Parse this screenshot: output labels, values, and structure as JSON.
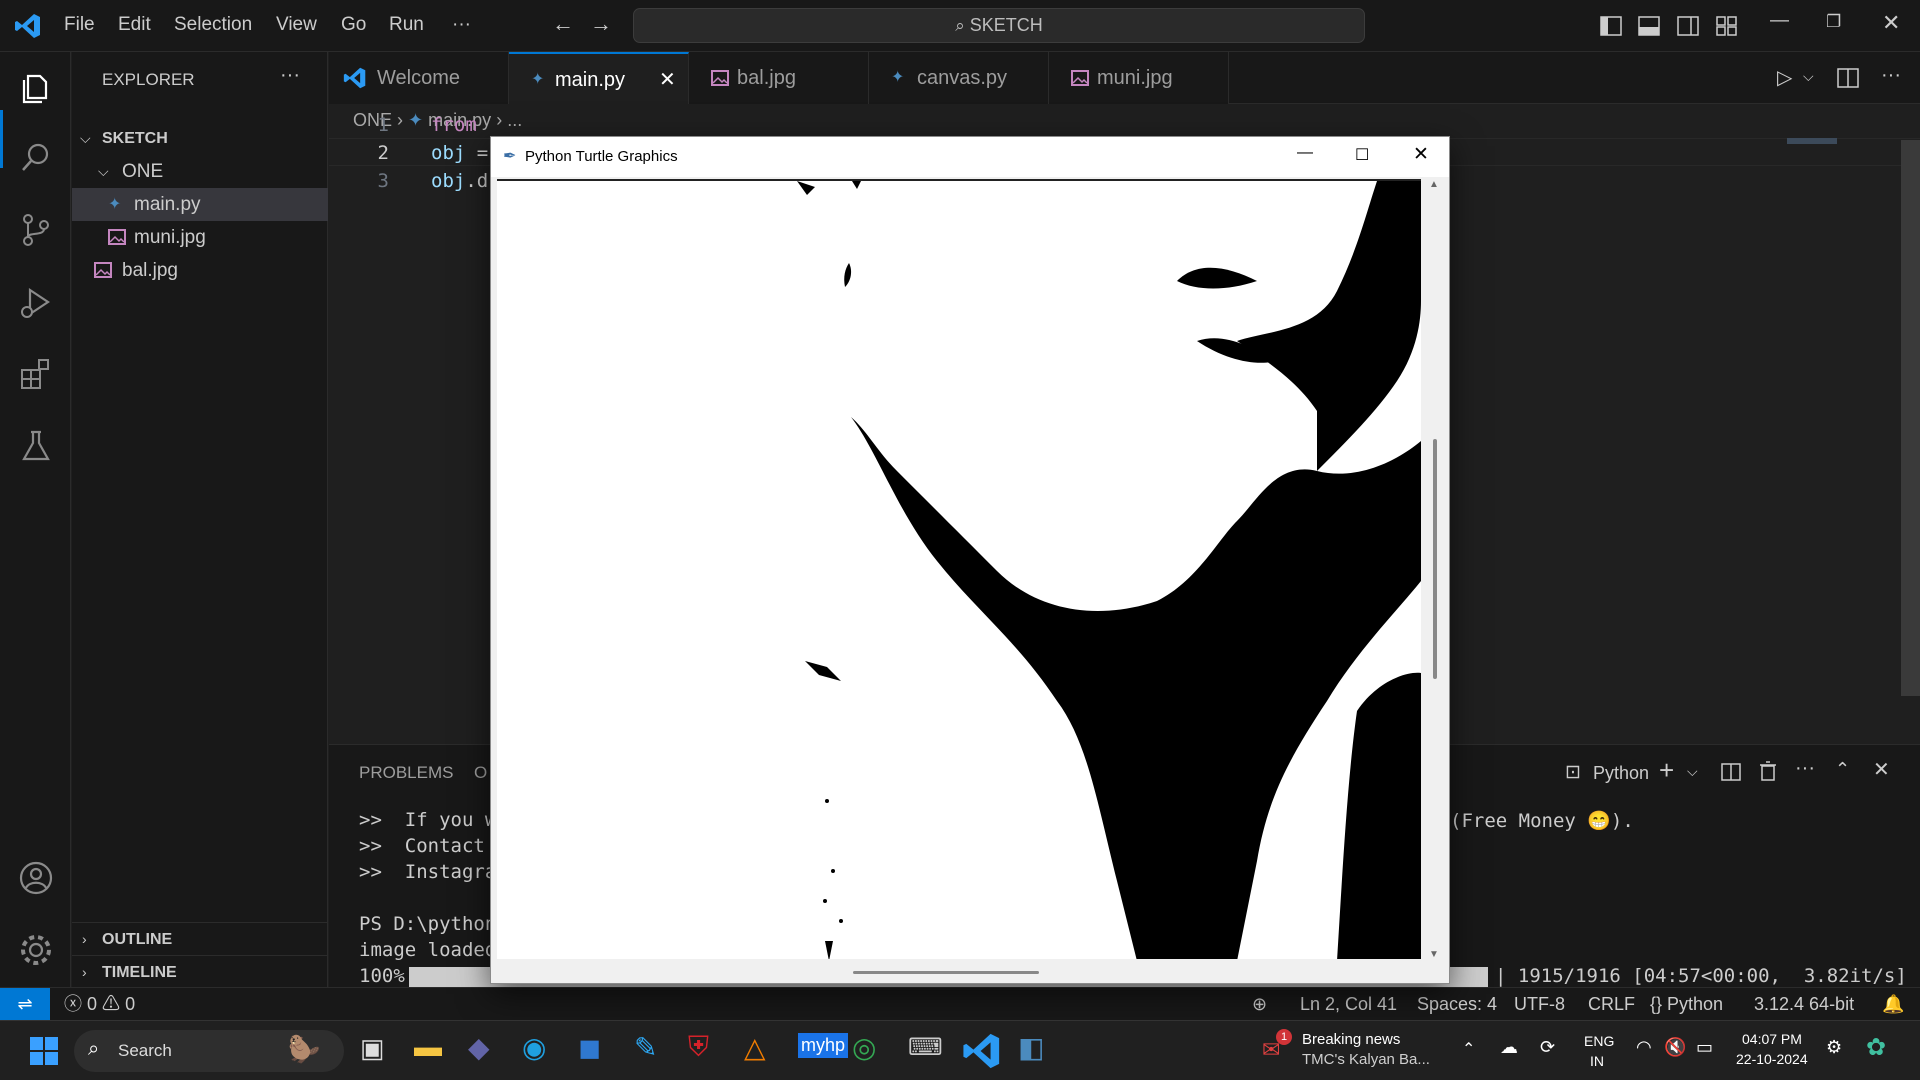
{
  "titlebar": {
    "menu": [
      "File",
      "Edit",
      "Selection",
      "View",
      "Go",
      "Run"
    ],
    "more": "···",
    "search_text": "SKETCH"
  },
  "sidebar": {
    "header": "EXPLORER",
    "more": "···",
    "root": "SKETCH",
    "folder": "ONE",
    "items": [
      {
        "label": "main.py",
        "type": "python",
        "selected": true
      },
      {
        "label": "muni.jpg",
        "type": "image",
        "selected": false
      },
      {
        "label": "bal.jpg",
        "type": "image",
        "selected": false
      }
    ],
    "outline": "OUTLINE",
    "timeline": "TIMELINE"
  },
  "tabs": [
    {
      "label": "Welcome",
      "type": "vscode",
      "active": false
    },
    {
      "label": "main.py",
      "type": "python",
      "active": true
    },
    {
      "label": "bal.jpg",
      "type": "image",
      "active": false
    },
    {
      "label": "canvas.py",
      "type": "python",
      "active": false
    },
    {
      "label": "muni.jpg",
      "type": "image",
      "active": false
    }
  ],
  "breadcrumb": {
    "folder": "ONE",
    "file": "main.py",
    "rest": "..."
  },
  "editor": {
    "lines": [
      {
        "no": "1",
        "kw": "from",
        "rest": ""
      },
      {
        "no": "2",
        "kw": "obj",
        "rest": " ="
      },
      {
        "no": "3",
        "kw": "obj",
        "rest": ".d"
      }
    ]
  },
  "panel": {
    "tabs": [
      "PROBLEMS",
      "O"
    ],
    "terminal_name": "Python",
    "lines": [
      ">>  If you w",
      ">>  Contact ",
      ">>  Instagra",
      "",
      "PS D:\\python",
      "image loaded",
      "100%|"
    ],
    "right_line": "(Free Money 😁).",
    "progress_text": "| 1915/1916 [04:57<00:00,  3.82it/s]",
    "progress": 0.999
  },
  "turtle_window": {
    "title": "Python Turtle Graphics"
  },
  "statusbar": {
    "errors": "0",
    "warnings": "0",
    "position": "Ln 2, Col 41",
    "spaces": "Spaces: 4",
    "encoding": "UTF-8",
    "eol": "CRLF",
    "language": "{} Python",
    "interpreter": "3.12.4 64-bit"
  },
  "taskbar": {
    "search": "Search",
    "news_title": "Breaking news",
    "news_sub": "TMC's Kalyan Ba...",
    "news_badge": "1",
    "lang1": "ENG",
    "lang2": "IN",
    "time": "04:07 PM",
    "date": "22-10-2024"
  },
  "colors": {
    "accent": "#0078d4",
    "python": "#4b8bbe",
    "image": "#c586c0",
    "keyword": "#c586c0",
    "variable": "#9cdcfe"
  }
}
